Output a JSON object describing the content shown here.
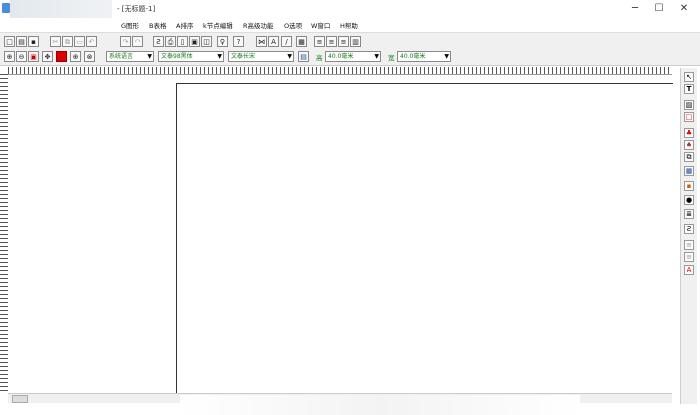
{
  "window": {
    "title": "- [无标题-1]"
  },
  "menu": [
    "G图形",
    "B表格",
    "A排序",
    "k节点编辑",
    "R高级功能",
    "O选项",
    "W窗口",
    "H帮助"
  ],
  "toolbar2": {
    "language": "系统语言",
    "font_name": "文泰98黑体",
    "font_style": "文泰长宋",
    "height_label": "高",
    "height_value": "40.0毫米",
    "width_label": "宽",
    "width_value": "40.0毫米"
  },
  "icons": {
    "toolbar1": [
      "new-icon",
      "open-icon",
      "save-icon",
      "cut-icon",
      "copy-icon",
      "paste-icon",
      "undo-icon",
      "redo-icon",
      "arc-text-icon",
      "bold-t-icon",
      "print-icon",
      "page-icon",
      "frame-icon",
      "bulb-icon",
      "help-icon",
      "path-icon",
      "text-box-icon",
      "italic-icon",
      "image-frame-icon",
      "align-left-icon",
      "align-center-icon",
      "align-right-icon",
      "align-justify-icon"
    ],
    "toolbar2": [
      "zoom-in-icon",
      "zoom-out-icon",
      "select-rect-icon",
      "move-icon",
      "color-icon",
      "zoom-plus-icon",
      "zoom-minus-icon",
      "layer-icon"
    ],
    "right": [
      "pointer-icon",
      "text-tool-icon",
      "image-tool-icon",
      "rect-tool-icon",
      "fill-icon",
      "stroke-icon",
      "copy-obj-icon",
      "table-tool-icon",
      "grid-icon",
      "paint-icon",
      "list-icon",
      "indent-icon",
      "line-up-icon",
      "line-down-icon",
      "text-effect-icon"
    ]
  }
}
